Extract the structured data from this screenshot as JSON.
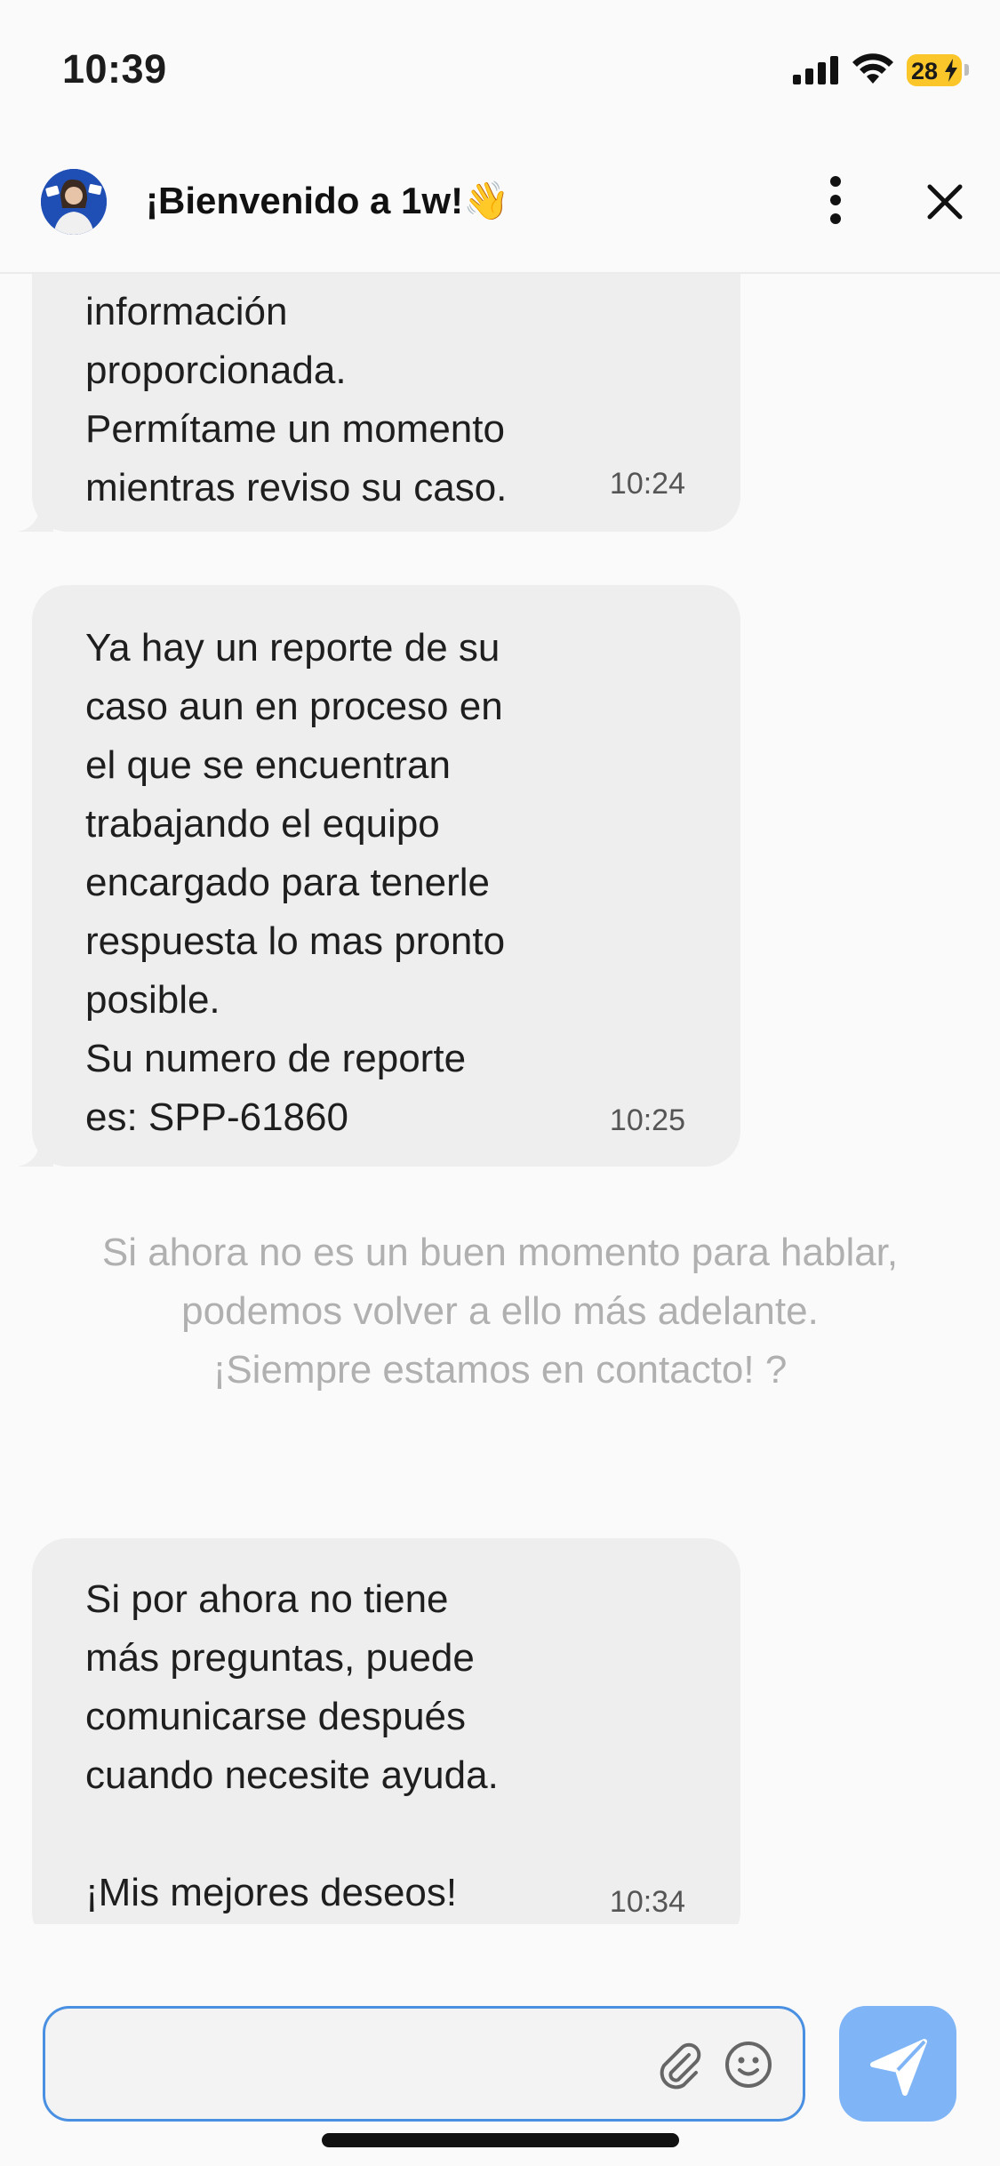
{
  "status_bar": {
    "time": "10:39",
    "battery": "28"
  },
  "header": {
    "title": "¡Bienvenido a 1w!👋"
  },
  "messages": [
    {
      "text": "información\nproporcionada.\nPermítame un momento\nmientras reviso su caso.",
      "time": "10:24"
    },
    {
      "text": "Ya hay un reporte de su\ncaso aun en proceso en\nel que se encuentran\ntrabajando el equipo\nencargado para tenerle\nrespuesta lo mas pronto\nposible.\nSu numero de reporte\nes: SPP-61860",
      "time": "10:25"
    },
    {
      "text": "Si por ahora no tiene\nmás preguntas, puede\ncomunicarse después\ncuando necesite ayuda.\n\n¡Mis mejores deseos!",
      "time": "10:34"
    }
  ],
  "system_note": "Si ahora no es un buen momento para hablar, podemos volver a ello más adelante. ¡Siempre estamos en contacto! ?",
  "composer": {
    "value": ""
  },
  "colors": {
    "accent": "#4a90e2",
    "send_button": "#7fb5f7",
    "bubble": "#eeeeee"
  }
}
